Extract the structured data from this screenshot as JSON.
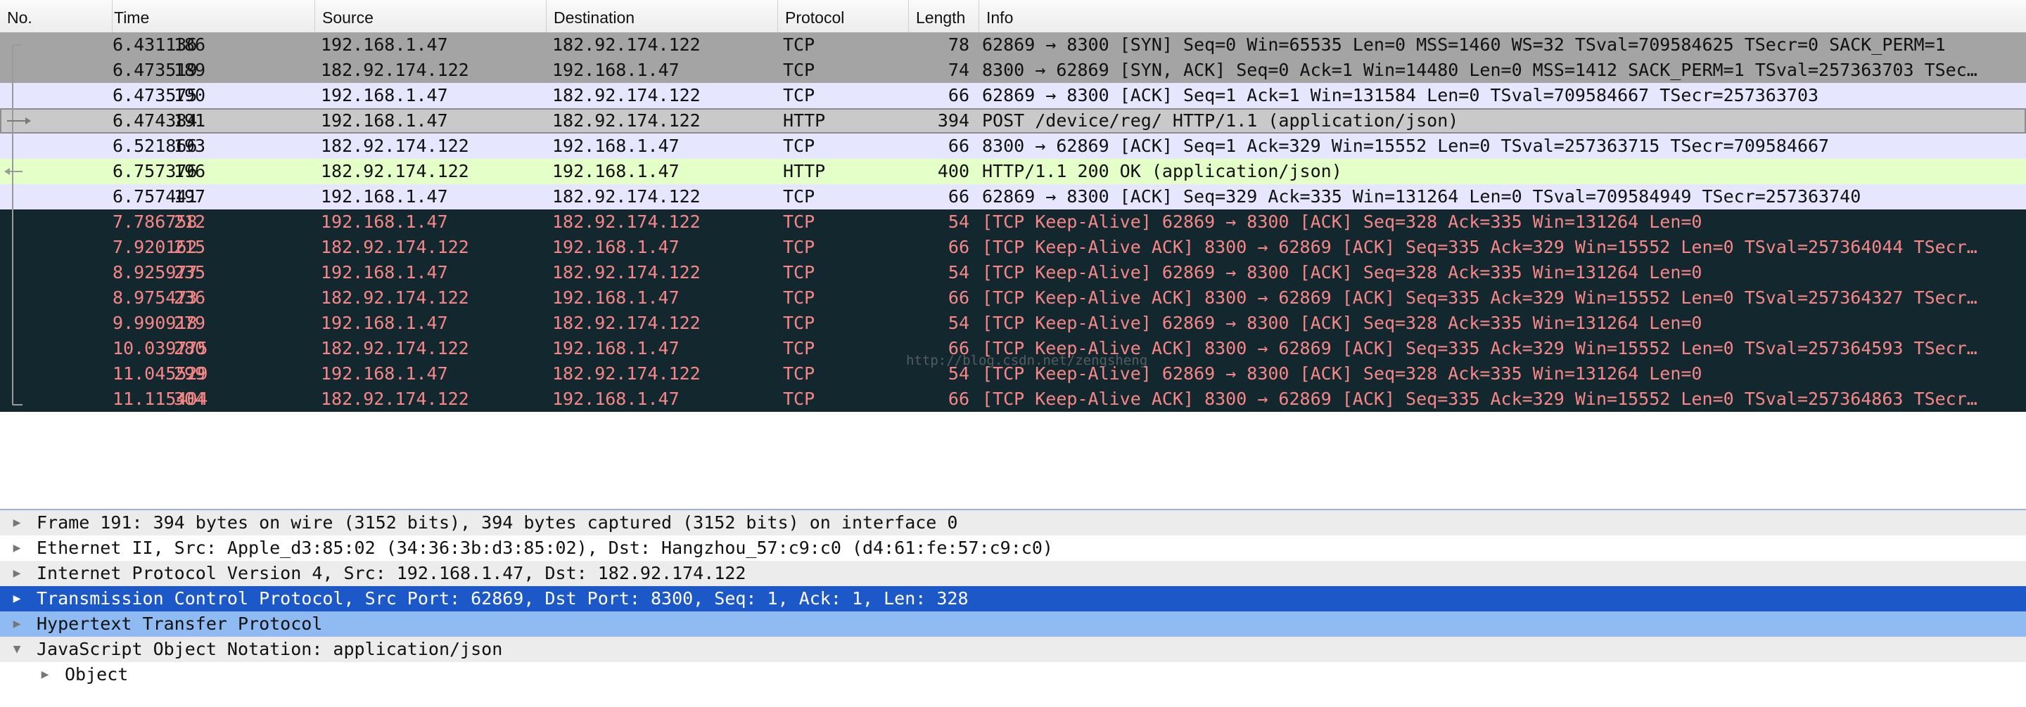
{
  "packet_list": {
    "columns": [
      "No.",
      "Time",
      "Source",
      "Destination",
      "Protocol",
      "Length",
      "Info"
    ],
    "rows": [
      {
        "no": "186",
        "time": "6.431136",
        "src": "192.168.1.47",
        "dst": "182.92.174.122",
        "proto": "TCP",
        "len": "78",
        "info": "62869 → 8300 [SYN] Seq=0 Win=65535 Len=0 MSS=1460 WS=32 TSval=709584625 TSecr=0 SACK_PERM=1"
      },
      {
        "no": "189",
        "time": "6.473519",
        "src": "182.92.174.122",
        "dst": "192.168.1.47",
        "proto": "TCP",
        "len": "74",
        "info": "8300 → 62869 [SYN, ACK] Seq=0 Ack=1 Win=14480 Len=0 MSS=1412 SACK_PERM=1 TSval=257363703 TSec…"
      },
      {
        "no": "190",
        "time": "6.473575",
        "src": "192.168.1.47",
        "dst": "182.92.174.122",
        "proto": "TCP",
        "len": "66",
        "info": "62869 → 8300 [ACK] Seq=1 Ack=1 Win=131584 Len=0 TSval=709584667 TSecr=257363703"
      },
      {
        "no": "191",
        "time": "6.474384",
        "src": "192.168.1.47",
        "dst": "182.92.174.122",
        "proto": "HTTP",
        "len": "394",
        "info": "POST /device/reg/ HTTP/1.1  (application/json)"
      },
      {
        "no": "193",
        "time": "6.521866",
        "src": "182.92.174.122",
        "dst": "192.168.1.47",
        "proto": "TCP",
        "len": "66",
        "info": "8300 → 62869 [ACK] Seq=1 Ack=329 Win=15552 Len=0 TSval=257363715 TSecr=709584667"
      },
      {
        "no": "196",
        "time": "6.757376",
        "src": "182.92.174.122",
        "dst": "192.168.1.47",
        "proto": "HTTP",
        "len": "400",
        "info": "HTTP/1.1 200 OK  (application/json)"
      },
      {
        "no": "197",
        "time": "6.757441",
        "src": "192.168.1.47",
        "dst": "182.92.174.122",
        "proto": "TCP",
        "len": "66",
        "info": "62869 → 8300 [ACK] Seq=329 Ack=335 Win=131264 Len=0 TSval=709584949 TSecr=257363740"
      },
      {
        "no": "212",
        "time": "7.786758",
        "src": "192.168.1.47",
        "dst": "182.92.174.122",
        "proto": "TCP",
        "len": "54",
        "info": "[TCP Keep-Alive] 62869 → 8300 [ACK] Seq=328 Ack=335 Win=131264 Len=0"
      },
      {
        "no": "215",
        "time": "7.920162",
        "src": "182.92.174.122",
        "dst": "192.168.1.47",
        "proto": "TCP",
        "len": "66",
        "info": "[TCP Keep-Alive ACK] 8300 → 62869 [ACK] Seq=335 Ack=329 Win=15552 Len=0 TSval=257364044 TSecr…"
      },
      {
        "no": "235",
        "time": "8.925977",
        "src": "192.168.1.47",
        "dst": "182.92.174.122",
        "proto": "TCP",
        "len": "54",
        "info": "[TCP Keep-Alive] 62869 → 8300 [ACK] Seq=328 Ack=335 Win=131264 Len=0"
      },
      {
        "no": "236",
        "time": "8.975473",
        "src": "182.92.174.122",
        "dst": "192.168.1.47",
        "proto": "TCP",
        "len": "66",
        "info": "[TCP Keep-Alive ACK] 8300 → 62869 [ACK] Seq=335 Ack=329 Win=15552 Len=0 TSval=257364327 TSecr…"
      },
      {
        "no": "279",
        "time": "9.990918",
        "src": "192.168.1.47",
        "dst": "182.92.174.122",
        "proto": "TCP",
        "len": "54",
        "info": "[TCP Keep-Alive] 62869 → 8300 [ACK] Seq=328 Ack=335 Win=131264 Len=0"
      },
      {
        "no": "280",
        "time": "10.039775",
        "src": "182.92.174.122",
        "dst": "192.168.1.47",
        "proto": "TCP",
        "len": "66",
        "info": "[TCP Keep-Alive ACK] 8300 → 62869 [ACK] Seq=335 Ack=329 Win=15552 Len=0 TSval=257364593 TSecr…"
      },
      {
        "no": "299",
        "time": "11.045529",
        "src": "192.168.1.47",
        "dst": "182.92.174.122",
        "proto": "TCP",
        "len": "54",
        "info": "[TCP Keep-Alive] 62869 → 8300 [ACK] Seq=328 Ack=335 Win=131264 Len=0"
      },
      {
        "no": "304",
        "time": "11.115404",
        "src": "182.92.174.122",
        "dst": "192.168.1.47",
        "proto": "TCP",
        "len": "66",
        "info": "[TCP Keep-Alive ACK] 8300 → 62869 [ACK] Seq=335 Ack=329 Win=15552 Len=0 TSval=257364863 TSecr…"
      }
    ],
    "watermark": "http://blog.csdn.net/zengsheng"
  },
  "details": {
    "items": [
      {
        "text": "Frame 191: 394 bytes on wire (3152 bits), 394 bytes captured (3152 bits) on interface 0"
      },
      {
        "text": "Ethernet II, Src: Apple_d3:85:02 (34:36:3b:d3:85:02), Dst: Hangzhou_57:c9:c0 (d4:61:fe:57:c9:c0)"
      },
      {
        "text": "Internet Protocol Version 4, Src: 192.168.1.47, Dst: 182.92.174.122"
      },
      {
        "text": "Transmission Control Protocol, Src Port: 62869, Dst Port: 8300, Seq: 1, Ack: 1, Len: 328"
      },
      {
        "text": "Hypertext Transfer Protocol"
      },
      {
        "text": "JavaScript Object Notation: application/json"
      },
      {
        "text": "Object"
      }
    ]
  },
  "colors": {
    "syn_row": "#a4a4a4",
    "tcp_row": "#e7e6ff",
    "http_row": "#e4ffc7",
    "bad_row_bg": "#12272e",
    "bad_row_fg": "#f78787",
    "selected_detail": "#1d58c9",
    "related_detail": "#8fbaf2"
  }
}
